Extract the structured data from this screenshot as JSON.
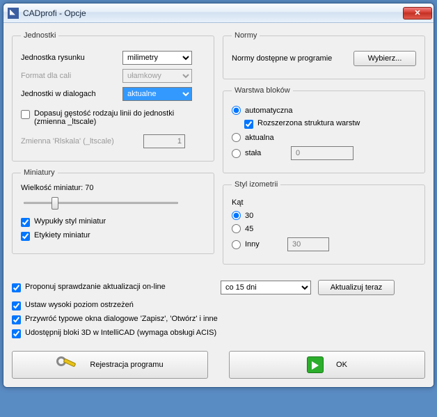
{
  "window": {
    "title": "CADprofi - Opcje"
  },
  "units": {
    "legend": "Jednostki",
    "drawingUnit_label": "Jednostka rysunku",
    "drawingUnit_value": "milimetry",
    "inchFormat_label": "Format dla cali",
    "inchFormat_value": "ułamkowy",
    "dialogUnits_label": "Jednostki w dialogach",
    "dialogUnits_value": "aktualne",
    "fitLinetype_label": "Dopasuj gęstość rodzaju linii do jednostki (zmienna _ltscale)",
    "rlscale_label": "Zmienna 'Rlskala' (_ltscale)",
    "rlscale_value": "1"
  },
  "norms": {
    "legend": "Normy",
    "available_label": "Normy dostępne w programie",
    "select_button": "Wybierz..."
  },
  "layers": {
    "legend": "Warstwa bloków",
    "auto_label": "automatyczna",
    "extended_label": "Rozszerzona struktura warstw",
    "current_label": "aktualna",
    "fixed_label": "stała",
    "fixed_value": "0"
  },
  "thumbs": {
    "legend": "Miniatury",
    "size_label": "Wielkość miniatur: 70",
    "convex_label": "Wypukły styl miniatur",
    "labels_label": "Etykiety miniatur"
  },
  "iso": {
    "legend": "Styl izometrii",
    "angle_label": "Kąt",
    "opt30": "30",
    "opt45": "45",
    "optOther": "Inny",
    "other_value": "30"
  },
  "bottom": {
    "checkUpdates_label": "Proponuj sprawdzanie aktualizacji on-line",
    "interval_value": "co 15 dni",
    "update_button": "Aktualizuj teraz",
    "highWarnings_label": "Ustaw wysoki poziom ostrzeżeń",
    "restoreDialogs_label": "Przywróć typowe okna dialogowe 'Zapisz', 'Otwórz' i inne",
    "enable3d_label": "Udostępnij bloki 3D w IntelliCAD (wymaga obsługi ACIS)",
    "register_button": "Rejestracja programu",
    "ok_button": "OK"
  }
}
